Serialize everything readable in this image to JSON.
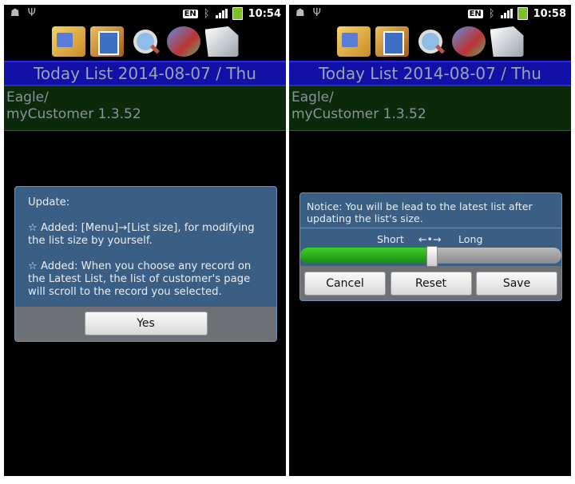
{
  "screens": [
    {
      "status": {
        "lang": "EN",
        "time": "10:54"
      },
      "title": "Today List 2014-08-07 / Thu",
      "list_item": {
        "line1": "Eagle/",
        "line2": "myCustomer 1.3.52"
      },
      "dialog": {
        "heading": "Update:",
        "para1": "☆ Added: [Menu]→[List size], for modifying the list size by yourself.",
        "para2": "☆ Added: When you choose any record on the Latest List, the list of customer's page will scroll to the record you selected.",
        "yes_label": "Yes"
      }
    },
    {
      "status": {
        "lang": "EN",
        "time": "10:58"
      },
      "title": "Today List 2014-08-07 / Thu",
      "list_item": {
        "line1": "Eagle/",
        "line2": "myCustomer 1.3.52"
      },
      "dialog": {
        "notice": "Notice: You will be lead to the latest list after updating the list's size.",
        "short_label": "Short",
        "arrows_label": "←•→",
        "long_label": "Long",
        "slider_value": 0.5,
        "cancel_label": "Cancel",
        "reset_label": "Reset",
        "save_label": "Save"
      }
    }
  ],
  "icons": {
    "status_left": [
      "android-icon",
      "usb-icon"
    ],
    "toolbar": [
      "folder-icon",
      "cards-icon",
      "search-icon",
      "clips-icon",
      "document-icon"
    ]
  },
  "colors": {
    "title_bar": "#1111a8",
    "list_item_bg": "#0a2a0a",
    "dialog_bg": "#3b5e85",
    "slider_fill": "#2aa81a"
  }
}
